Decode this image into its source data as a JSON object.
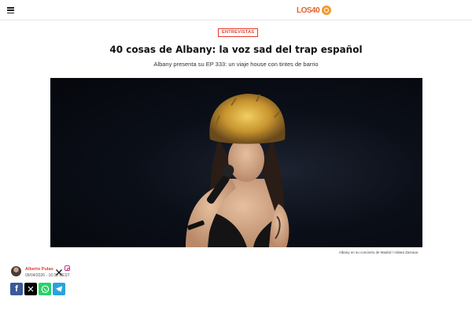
{
  "header": {
    "menu_icon": "hamburger-icon",
    "logo_text": "LOS40",
    "logo_badge_icon": "radio-badge-icon"
  },
  "article": {
    "section": "ENTREVISTAS",
    "title": "40 cosas de Albany: la voz sad del trap español",
    "subtitle": "Albany presenta su EP 333: un viaje house con tintes de barrio",
    "image_caption": "Albany en su concierto de Madrid / Aldara Zarraoa"
  },
  "author": {
    "name": "Alberto Pulao",
    "date": "09/04/2026 - 16:32 CEST",
    "social_icons": [
      "x-icon",
      "instagram-icon"
    ]
  },
  "share": {
    "buttons": [
      "facebook-icon",
      "x-icon",
      "whatsapp-icon",
      "telegram-icon"
    ]
  },
  "colors": {
    "accent": "#e5392b",
    "brand_orange": "#e8602c",
    "facebook": "#3b5998",
    "whatsapp": "#25d366",
    "telegram": "#2aa3dd"
  }
}
